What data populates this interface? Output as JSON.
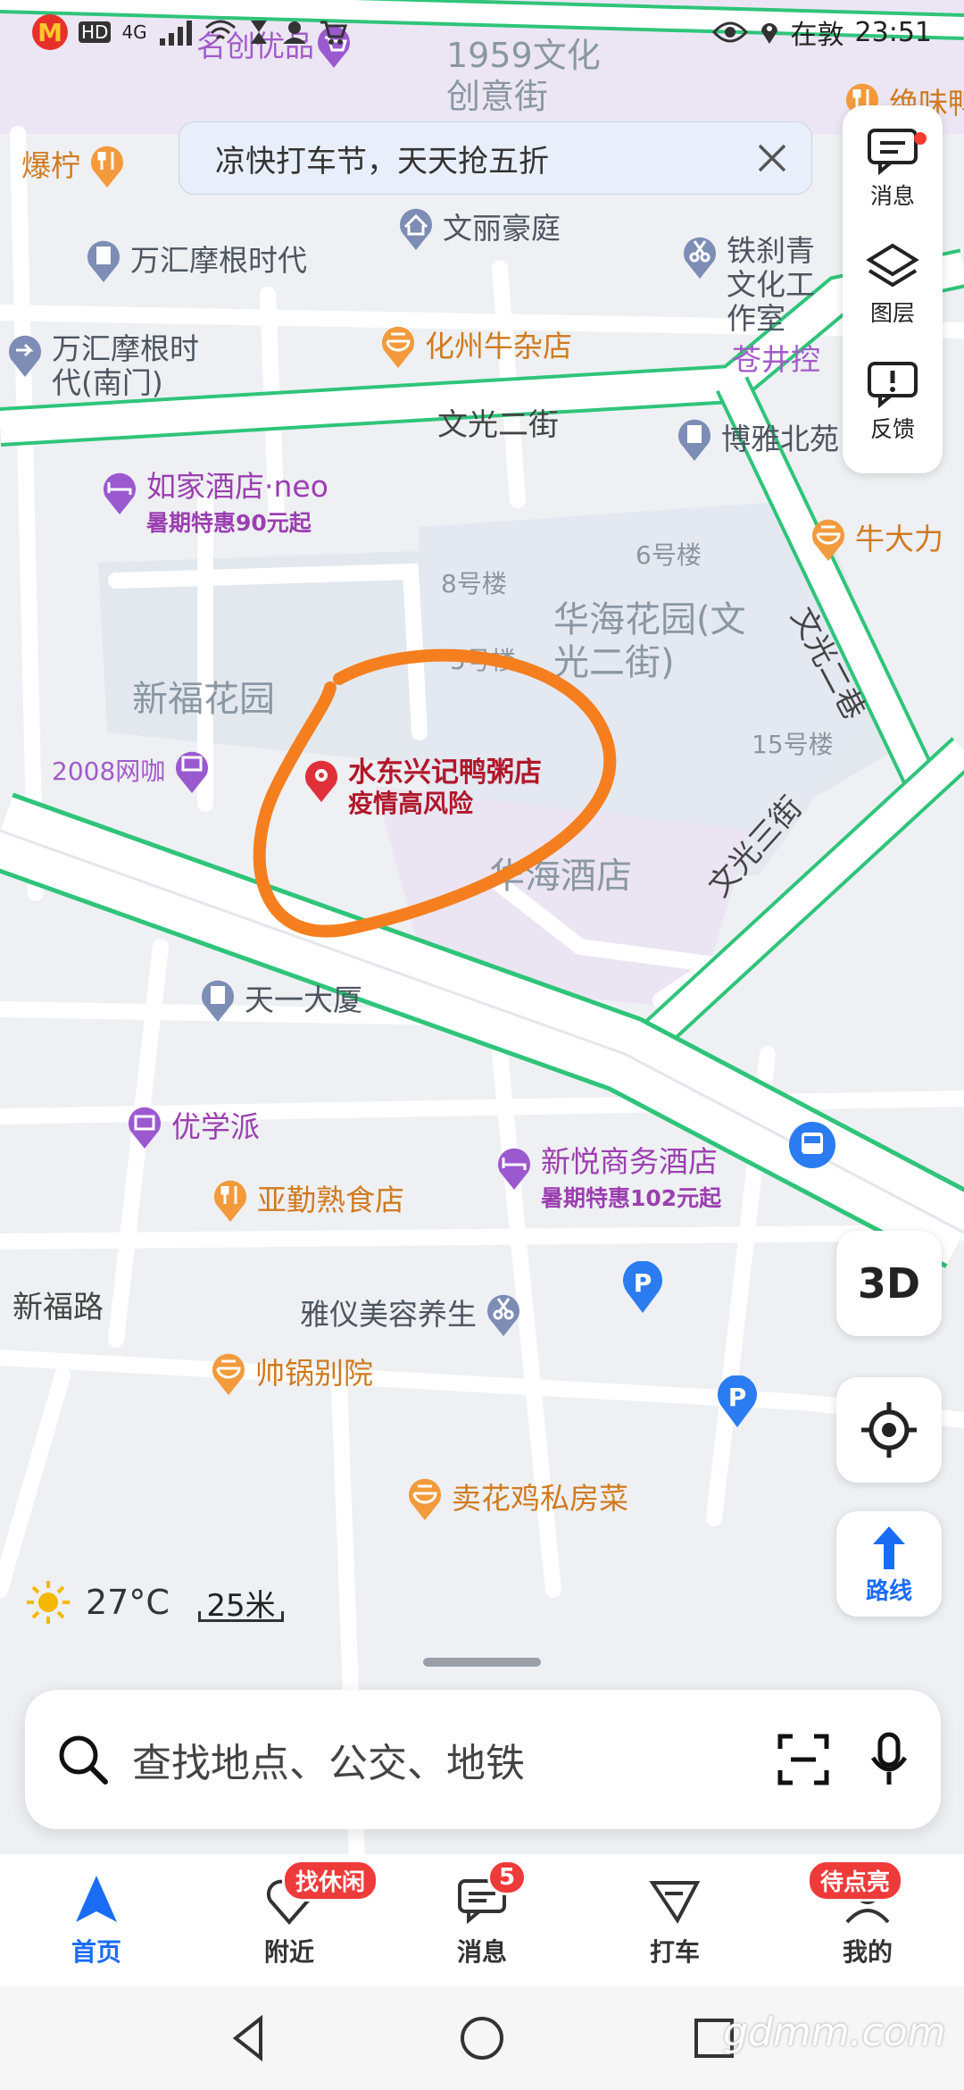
{
  "status_bar": {
    "network": "4G",
    "hd": "HD",
    "carrier_text": "在敦",
    "time": "23:51"
  },
  "banner": {
    "text": "凉快打车节，天天抢五折"
  },
  "toolbox": {
    "messages": "消息",
    "layers": "图层",
    "feedback": "反馈"
  },
  "map": {
    "area_labels": [
      "1959文化创意街",
      "新福花园",
      "华海花园(文光二街)",
      "华海酒店"
    ],
    "road_labels": [
      "文光二街",
      "文光三街",
      "文光二巷",
      "新福路"
    ],
    "building_labels": [
      "8号楼",
      "5号楼",
      "6号楼",
      "15号楼"
    ],
    "pois": [
      {
        "name": "名创优品"
      },
      {
        "name": "爆柠"
      },
      {
        "name": "万汇摩根时代"
      },
      {
        "name": "文丽豪庭"
      },
      {
        "name": "铁刹青文化工作室"
      },
      {
        "name": "万汇摩根时代(南门)"
      },
      {
        "name": "化州牛杂店"
      },
      {
        "name": "苍井控"
      },
      {
        "name": "博雅北苑"
      },
      {
        "name": "如家酒店·neo",
        "promo": "暑期特惠90元起"
      },
      {
        "name": "牛大力"
      },
      {
        "name": "2008网咖"
      },
      {
        "name": "天一大厦"
      },
      {
        "name": "优学派"
      },
      {
        "name": "新悦商务酒店",
        "promo": "暑期特惠102元起"
      },
      {
        "name": "亚勤熟食店"
      },
      {
        "name": "雅仪美容养生"
      },
      {
        "name": "帅锅别院"
      },
      {
        "name": "卖花鸡私房菜"
      },
      {
        "name": "绝味鸭"
      }
    ],
    "highlight_poi": {
      "name": "水东兴记鸭粥店",
      "note": "疫情高风险"
    }
  },
  "fabs": {
    "three_d": "3D",
    "route": "路线"
  },
  "weather": {
    "temp": "27°C"
  },
  "scale": {
    "label": "25米"
  },
  "search": {
    "placeholder": "查找地点、公交、地铁"
  },
  "tabs": [
    {
      "label": "首页"
    },
    {
      "label": "附近",
      "badge": "找休闲"
    },
    {
      "label": "消息",
      "badge": "5"
    },
    {
      "label": "打车"
    },
    {
      "label": "我的",
      "badge": "待点亮"
    }
  ],
  "watermark": "gdmm.com",
  "colors": {
    "accent": "#1a6cf5",
    "road_border": "#2fc47a",
    "poi_purple": "#9b59d0",
    "poi_orange": "#f29a3c",
    "poi_blue": "#7d8db5",
    "alert_red": "#e0303a",
    "annotation": "#f57f1e"
  }
}
